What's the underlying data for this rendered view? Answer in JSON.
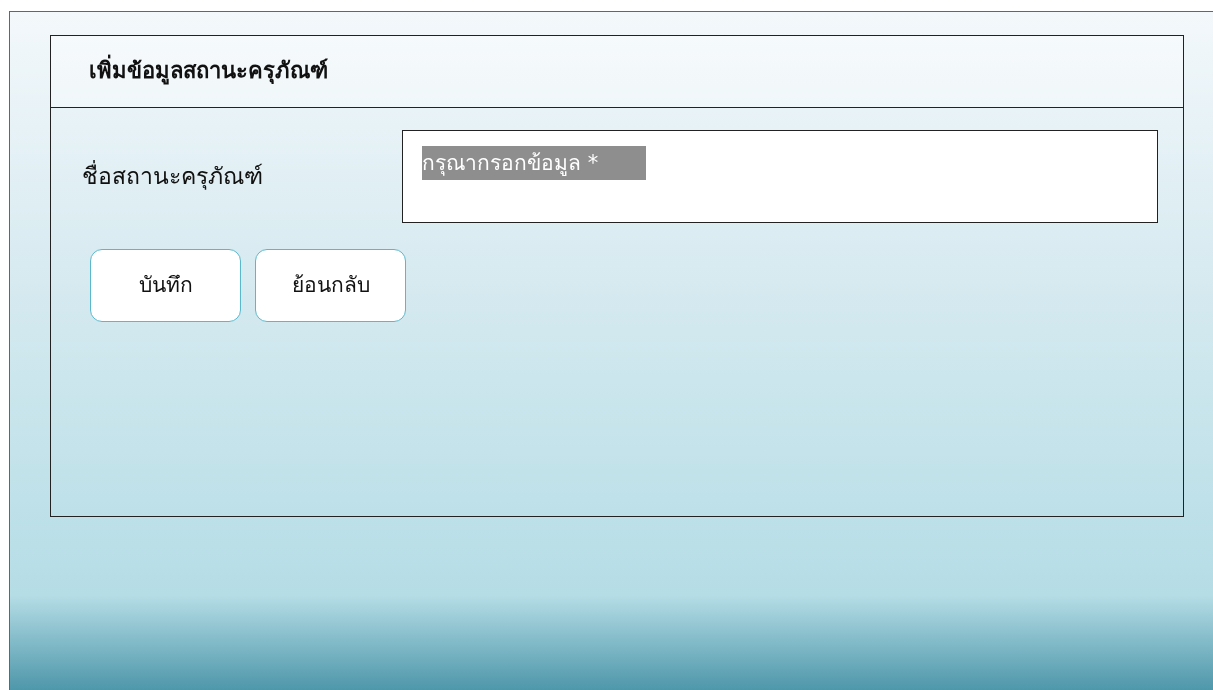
{
  "form": {
    "title": "เพิ่มข้อมูลสถานะครุภัณฑ์",
    "fields": [
      {
        "label": "ชื่อสถานะครุภัณฑ์",
        "placeholder": "กรุณากรอกข้อมูล *"
      }
    ],
    "buttons": [
      "บันทึก",
      "ย้อนกลับ"
    ]
  }
}
